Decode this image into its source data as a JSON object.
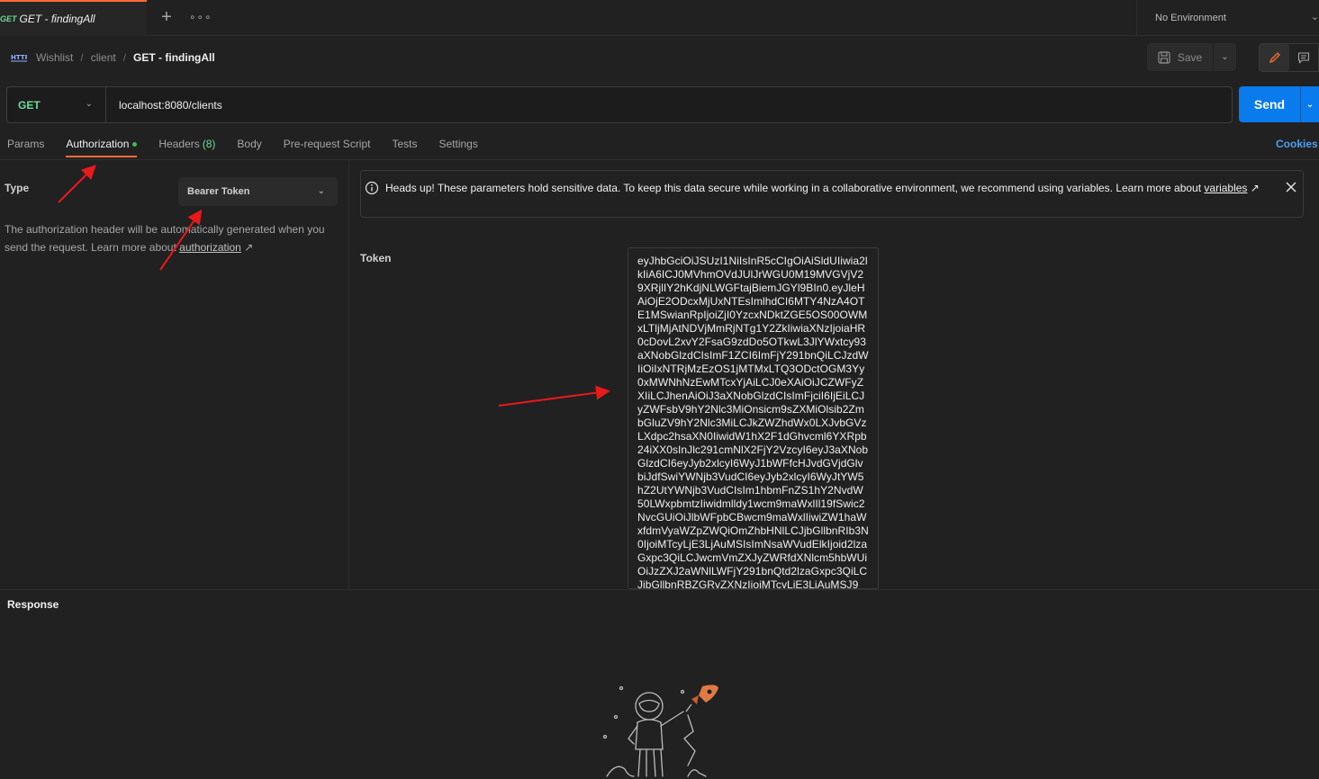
{
  "tabs": {
    "active": {
      "method": "GET",
      "title": "GET - findingAll"
    },
    "add_label": "+",
    "more_label": "∘∘∘"
  },
  "environment": {
    "label": "No Environment"
  },
  "breadcrumb": {
    "collection": "Wishlist",
    "folder": "client",
    "request": "GET - findingAll",
    "separator": "/"
  },
  "toolbar": {
    "save_label": "Save"
  },
  "request": {
    "method": "GET",
    "url": "localhost:8080/clients",
    "send_label": "Send"
  },
  "subtabs": {
    "params": "Params",
    "authorization": "Authorization",
    "headers": "Headers",
    "headers_count": "(8)",
    "body": "Body",
    "pre_request": "Pre-request Script",
    "tests": "Tests",
    "settings": "Settings",
    "cookies": "Cookies"
  },
  "auth": {
    "type_label": "Type",
    "type_value": "Bearer Token",
    "description": "The authorization header will be automatically generated when you send the request. Learn more about",
    "description_link": "authorization",
    "link_arrow": "↗"
  },
  "alert": {
    "text": "Heads up! These parameters hold sensitive data. To keep this data secure while working in a collaborative environment, we recommend using variables. Learn more about",
    "link": "variables",
    "link_arrow": "↗"
  },
  "token": {
    "label": "Token",
    "value": "eyJhbGciOiJSUzI1NiIsInR5cCIgOiAiSldUIiwia2lkIiA6ICJ0MVhmOVdJUlJrWGU0M19MVGVjV29XRjlIY2hKdjNLWGFtajBiemJGYl9BIn0.eyJleHAiOjE2ODcxMjUxNTEsImlhdCI6MTY4NzA4OTE1MSwianRpIjoiZjI0YzcxNDktZGE5OS00OWMxLTljMjAtNDVjMmRjNTg1Y2ZkIiwiaXNzIjoiaHR0cDovL2xvY2FsaG9zdDo5OTkwL3JlYWxtcy93aXNobGlzdCIsImF1ZCI6ImFjY291bnQiLCJzdWIiOiIxNTRjMzEzOS1jMTMxLTQ3ODctOGM3Yy0xMWNhNzEwMTcxYjAiLCJ0eXAiOiJCZWFyZXIiLCJhenAiOiJ3aXNobGlzdCIsImFjciI6IjEiLCJyZWFsbV9hY2Nlc3MiOnsicm9sZXMiOlsib2ZmbGluZV9hY2Nlc3MiLCJkZWZhdWx0LXJvbGVzLXdpc2hsaXN0IiwidW1hX2F1dGhvcml6YXRpb24iXX0sInJlc291cmNlX2FjY2VzcyI6eyJ3aXNobGlzdCI6eyJyb2xlcyI6WyJ1bWFfcHJvdGVjdGlvbiJdfSwiYWNjb3VudCI6eyJyb2xlcyI6WyJtYW5hZ2UtYWNjb3VudCIsIm1hbmFnZS1hY2NvdW50LWxpbmtzIiwidmlldy1wcm9maWxlIl19fSwic2NvcGUiOiJlbWFpbCBwcm9maWxlIiwiZW1haWxfdmVyaWZpZWQiOmZhbHNlLCJjbGllbnRIb3N0IjoiMTcyLjE3LjAuMSIsImNsaWVudElkIjoid2lzaGxpc3QiLCJwcmVmZXJyZWRfdXNlcm5hbWUiOiJzZXJ2aWNlLWFjY291bnQtd2lzaGxpc3QiLCJjbGllbnRBZGRyZXNzIjoiMTcyLjE3LjAuMSJ9"
  },
  "response": {
    "label": "Response"
  },
  "colors": {
    "accent_orange": "#ff6c37",
    "method_green": "#6bdd9a",
    "send_blue": "#097bed",
    "cookies_blue": "#4d9ff0",
    "annotation_red": "#e8191a"
  }
}
